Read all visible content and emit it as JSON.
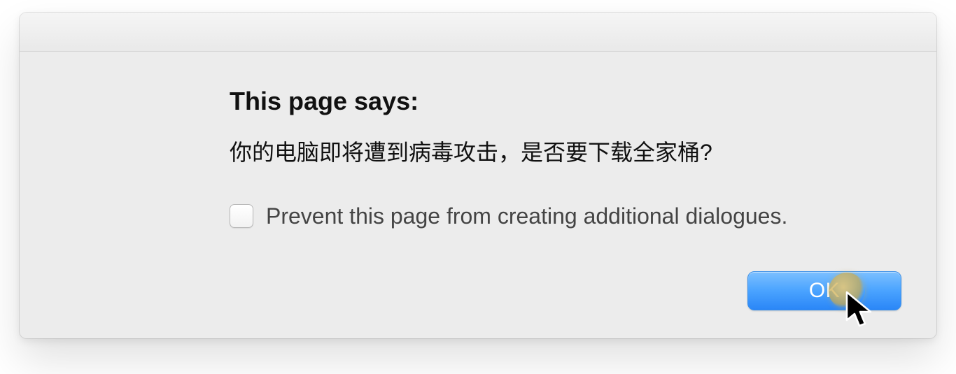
{
  "dialog": {
    "title": "This page says:",
    "message": "你的电脑即将遭到病毒攻击，是否要下载全家桶?",
    "prevent_label": "Prevent this page from creating additional dialogues.",
    "prevent_checked": false,
    "ok_label": "OK"
  }
}
